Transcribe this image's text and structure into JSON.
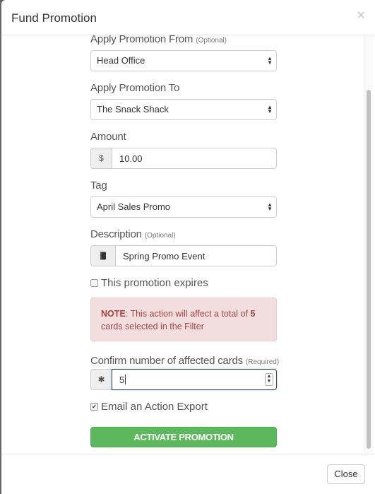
{
  "modal": {
    "title": "Fund Promotion",
    "close_glyph": "×"
  },
  "form": {
    "apply_from": {
      "label": "Apply Promotion From",
      "hint": "(Optional)",
      "value": "Head Office"
    },
    "apply_to": {
      "label": "Apply Promotion To",
      "value": "The Snack Shack"
    },
    "amount": {
      "label": "Amount",
      "addon": "$",
      "value": "10.00"
    },
    "tag": {
      "label": "Tag",
      "value": "April Sales Promo"
    },
    "description": {
      "label": "Description",
      "hint": "(Optional)",
      "icon": "book-icon",
      "value": "Spring Promo Event"
    },
    "expires": {
      "label": "This promotion expires",
      "checked": false
    },
    "note": {
      "prefix": "NOTE",
      "text_1": ": This action will affect a total of ",
      "count": "5",
      "text_2": " cards selected in the Filter"
    },
    "confirm": {
      "label": "Confirm number of affected cards",
      "hint": "(Required)",
      "addon_glyph": "✱",
      "value": "5"
    },
    "email_export": {
      "label": "Email an Action Export",
      "checked": true
    },
    "activate_label": "ACTIVATE PROMOTION"
  },
  "footer": {
    "close_label": "Close"
  },
  "colors": {
    "success": "#5cb85c",
    "danger_bg": "#f2dede",
    "danger_text": "#a94442"
  }
}
